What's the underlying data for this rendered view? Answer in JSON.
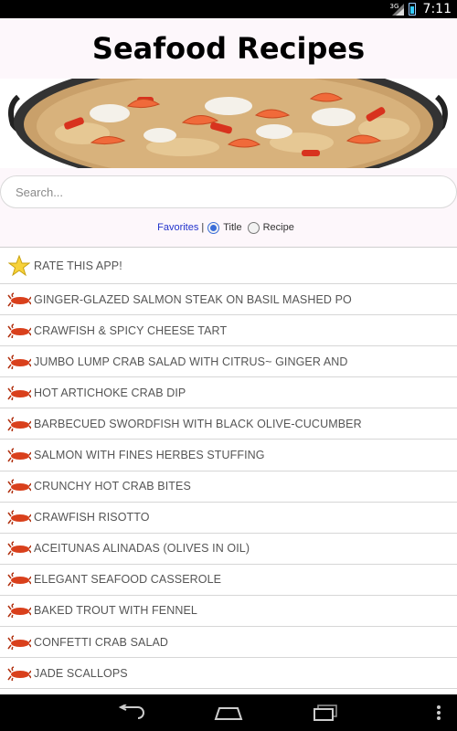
{
  "status_bar": {
    "network": "3G",
    "time": "7:11"
  },
  "header": {
    "title": "Seafood Recipes"
  },
  "search": {
    "placeholder": "Search..."
  },
  "filter": {
    "favorites_label": "Favorites",
    "separator": "|",
    "options": [
      {
        "label": "Title",
        "checked": true
      },
      {
        "label": "Recipe",
        "checked": false
      }
    ]
  },
  "list": {
    "items": [
      {
        "label": "RATE THIS APP!",
        "icon": "star-icon"
      },
      {
        "label": "GINGER-GLAZED SALMON STEAK ON BASIL MASHED PO",
        "icon": "crawfish-icon"
      },
      {
        "label": "CRAWFISH & SPICY CHEESE TART",
        "icon": "crawfish-icon"
      },
      {
        "label": "JUMBO LUMP CRAB SALAD WITH CITRUS~ GINGER AND",
        "icon": "crawfish-icon"
      },
      {
        "label": "HOT ARTICHOKE CRAB DIP",
        "icon": "crawfish-icon"
      },
      {
        "label": "BARBECUED SWORDFISH WITH BLACK OLIVE-CUCUMBER",
        "icon": "crawfish-icon"
      },
      {
        "label": "SALMON WITH FINES HERBES STUFFING",
        "icon": "crawfish-icon"
      },
      {
        "label": "CRUNCHY HOT CRAB BITES",
        "icon": "crawfish-icon"
      },
      {
        "label": "CRAWFISH RISOTTO",
        "icon": "crawfish-icon"
      },
      {
        "label": "ACEITUNAS ALINADAS (OLIVES IN OIL)",
        "icon": "crawfish-icon"
      },
      {
        "label": "ELEGANT SEAFOOD CASSEROLE",
        "icon": "crawfish-icon"
      },
      {
        "label": "BAKED TROUT WITH FENNEL",
        "icon": "crawfish-icon"
      },
      {
        "label": "CONFETTI CRAB SALAD",
        "icon": "crawfish-icon"
      },
      {
        "label": "JADE SCALLOPS",
        "icon": "crawfish-icon"
      }
    ]
  },
  "colors": {
    "header_bg": "#fdf7fb",
    "link": "#2233cc",
    "radio_accent": "#3a6dd8",
    "row_text": "#555555"
  }
}
